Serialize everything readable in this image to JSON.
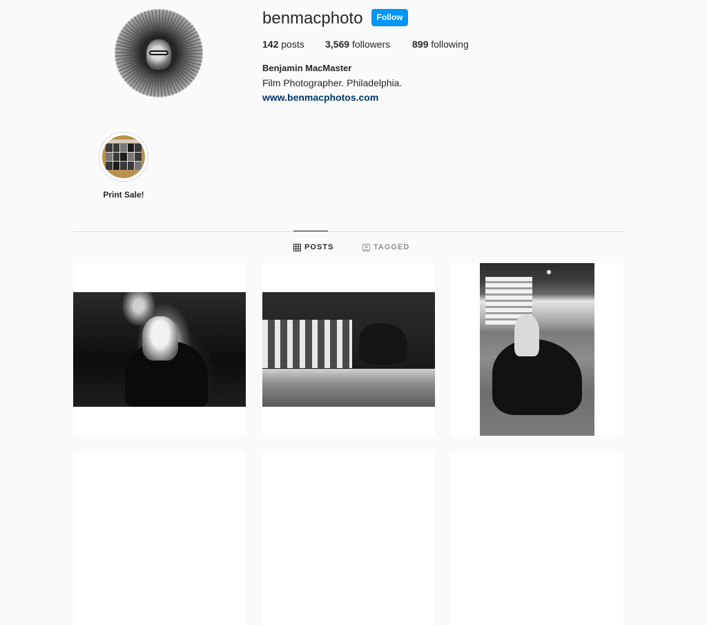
{
  "profile": {
    "username": "benmacphoto",
    "follow_label": "Follow",
    "stats": {
      "posts_count": "142",
      "posts_label": "posts",
      "followers_count": "3,569",
      "followers_label": "followers",
      "following_count": "899",
      "following_label": "following"
    },
    "full_name": "Benjamin MacMaster",
    "bio": "Film Photographer. Philadelphia.",
    "website": "www.benmacphotos.com"
  },
  "highlights": [
    {
      "label": "Print Sale!"
    }
  ],
  "tabs": [
    {
      "label": "POSTS",
      "icon": "grid-icon",
      "active": true
    },
    {
      "label": "TAGGED",
      "icon": "tag-icon",
      "active": false
    }
  ],
  "colors": {
    "follow_button": "#0095f6",
    "link": "#00376b",
    "background": "#fafafa"
  }
}
